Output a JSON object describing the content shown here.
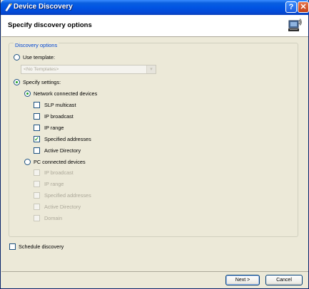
{
  "window": {
    "title": "Device Discovery"
  },
  "header": {
    "title": "Specify discovery options"
  },
  "discovery_options": {
    "legend": "Discovery options",
    "use_template": {
      "label": "Use template:",
      "selected": false
    },
    "template_combo": {
      "value": "<No Templates>"
    },
    "specify_settings": {
      "label": "Specify settings:",
      "selected": true
    },
    "network": {
      "label": "Network connected devices",
      "selected": true,
      "items": [
        {
          "label": "SLP multicast",
          "checked": false
        },
        {
          "label": "IP broadcast",
          "checked": false
        },
        {
          "label": "IP range",
          "checked": false
        },
        {
          "label": "Specified addresses",
          "checked": true
        },
        {
          "label": "Active Directory",
          "checked": false
        }
      ]
    },
    "pc": {
      "label": "PC connected devices",
      "selected": false,
      "items": [
        {
          "label": "IP broadcast",
          "checked": false
        },
        {
          "label": "IP range",
          "checked": false
        },
        {
          "label": "Specified addresses",
          "checked": false
        },
        {
          "label": "Active Directory",
          "checked": false
        },
        {
          "label": "Domain",
          "checked": false
        }
      ]
    }
  },
  "schedule": {
    "label": "Schedule discovery",
    "checked": false
  },
  "buttons": {
    "next": "Next >",
    "cancel": "Cancel"
  },
  "icons": {
    "title": "device-discovery-icon",
    "header": "networked-computer-icon",
    "help": "help-icon",
    "close": "close-icon"
  },
  "colors": {
    "title_bar": "#0054e3",
    "legend_text": "#0046d5",
    "check_mark": "#21a121",
    "disabled_text": "#aca899"
  }
}
